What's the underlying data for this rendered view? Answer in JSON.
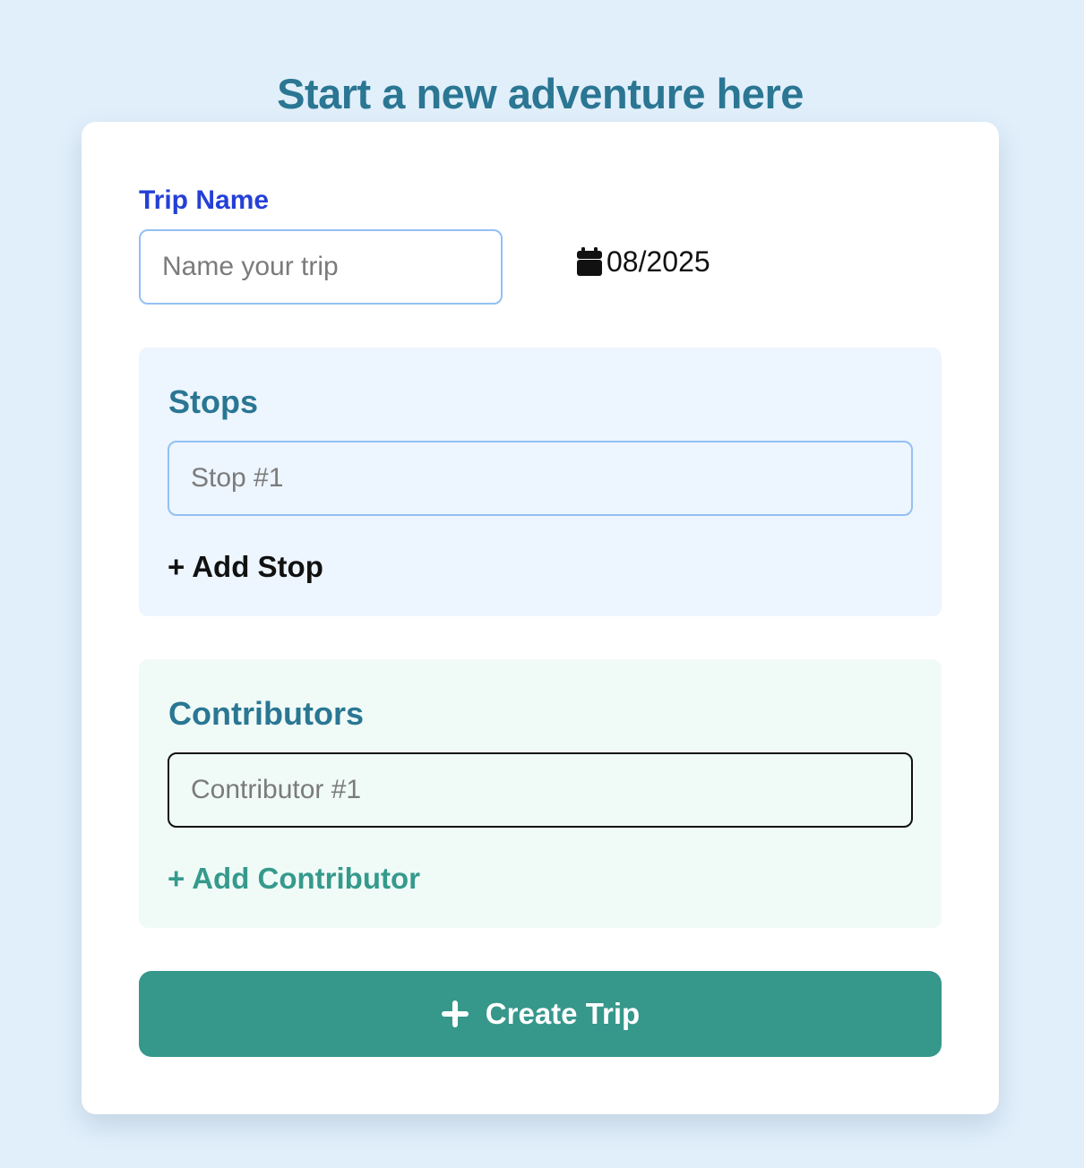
{
  "header": {
    "title": "Start a new adventure here"
  },
  "form": {
    "trip_name": {
      "label": "Trip Name",
      "placeholder": "Name your trip",
      "value": ""
    },
    "date": {
      "icon": "calendar-icon",
      "value": "08/2025"
    },
    "stops": {
      "title": "Stops",
      "inputs": [
        {
          "placeholder": "Stop #1",
          "value": ""
        }
      ],
      "add_label": "+ Add Stop"
    },
    "contributors": {
      "title": "Contributors",
      "inputs": [
        {
          "placeholder": "Contributor #1",
          "value": ""
        }
      ],
      "add_label": "+ Add Contributor"
    },
    "submit": {
      "icon": "plus-icon",
      "label": "Create Trip"
    }
  },
  "colors": {
    "page_background": "#e1effb",
    "title": "#2a7693",
    "trip_label": "#2440d6",
    "stops_background": "#edf5fe",
    "contributors_background": "#f0fbf8",
    "accent_teal": "#36978b",
    "input_border_blue": "#93c0f3"
  }
}
